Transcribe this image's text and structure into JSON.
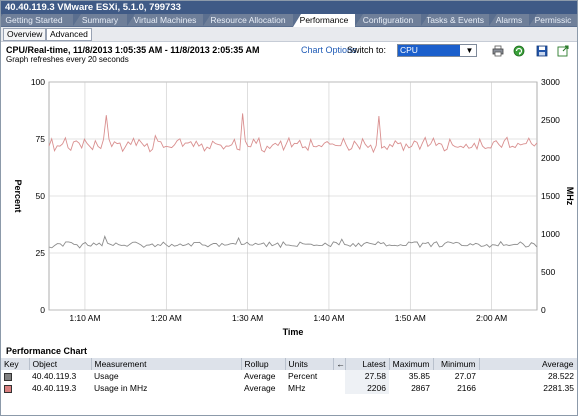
{
  "window": {
    "title": "40.40.119.3 VMware ESXi, 5.1.0, 799733"
  },
  "tabs": [
    {
      "label": "Getting Started"
    },
    {
      "label": "Summary"
    },
    {
      "label": "Virtual Machines"
    },
    {
      "label": "Resource Allocation"
    },
    {
      "label": "Performance"
    },
    {
      "label": "Configuration"
    },
    {
      "label": "Tasks & Events"
    },
    {
      "label": "Alarms"
    },
    {
      "label": "Permissic"
    }
  ],
  "subtabs": [
    {
      "label": "Overview"
    },
    {
      "label": "Advanced"
    }
  ],
  "chart_header": {
    "title": "CPU/Real-time, 11/8/2013 1:05:35 AM - 11/8/2013 2:05:35 AM",
    "chart_options_link": "Chart Options",
    "switch_label": "Switch to:",
    "switch_value": "CPU",
    "refresh_note": "Graph refreshes every 20 seconds"
  },
  "toolbar_icons": [
    {
      "name": "print-icon"
    },
    {
      "name": "refresh-icon"
    },
    {
      "name": "save-icon"
    },
    {
      "name": "popout-icon"
    }
  ],
  "colors": {
    "usage": "#d98f8f",
    "usage_mhz": "#8c8c8c",
    "swatch_usage": "#808080",
    "swatch_mhz": "#d98080",
    "grid": "#c8c8c8"
  },
  "chart_data": {
    "type": "line",
    "xlabel": "Time",
    "ylabel": "Percent",
    "y2label": "MHz",
    "ylim": [
      0,
      100
    ],
    "y2lim": [
      0,
      3000
    ],
    "yticks": [
      "0",
      "25",
      "50",
      "75",
      "100"
    ],
    "y2ticks": [
      "0",
      "500",
      "1000",
      "1500",
      "2000",
      "2500",
      "3000"
    ],
    "x_range_minutes": [
      65.58,
      125.58
    ],
    "xticks": [
      {
        "label": "1:10 AM",
        "minute": 70
      },
      {
        "label": "1:20 AM",
        "minute": 80
      },
      {
        "label": "1:30 AM",
        "minute": 90
      },
      {
        "label": "1:40 AM",
        "minute": 100
      },
      {
        "label": "1:50 AM",
        "minute": 110
      },
      {
        "label": "2:00 AM",
        "minute": 120
      }
    ],
    "grid": true,
    "series": [
      {
        "name": "Usage in MHz",
        "axis": "right",
        "values": [
          2156,
          2252,
          2095,
          2160,
          2156,
          2187,
          2266,
          2134,
          2101,
          2210,
          2225,
          2197,
          2131,
          2248,
          2190,
          2150,
          2111,
          2228,
          2151,
          2125,
          2245,
          2563,
          2246,
          2150,
          2213,
          2190,
          2198,
          2088,
          2146,
          2212,
          2178,
          2259,
          2165,
          2242,
          2197,
          2154,
          2188,
          2083,
          2116,
          2294,
          2218,
          2213,
          2139,
          2154,
          2146,
          2137,
          2171,
          2228,
          2252,
          2153,
          2196,
          2197,
          2215,
          2151,
          2221,
          2156,
          2184,
          2094,
          2144,
          2122,
          2221,
          2191,
          2179,
          2169,
          2118,
          2158,
          2155,
          2174,
          2245,
          2117,
          2105,
          2587,
          2224,
          2151,
          2148,
          2248,
          2194,
          2262,
          2103,
          2079,
          2155,
          2125,
          2171,
          2193,
          2165,
          2222,
          2105,
          2182,
          2265,
          2146,
          2193,
          2190,
          2231,
          2136,
          2147,
          2103,
          2244,
          2151,
          2147,
          2166,
          2149,
          2196,
          2216,
          2183,
          2185,
          2167,
          2162,
          2162,
          2257,
          2170,
          2103,
          2123,
          2221,
          2175,
          2118,
          2252,
          2182,
          2138,
          2170,
          2078,
          2164,
          2551,
          2131,
          2151,
          2112,
          2179,
          2150,
          2226,
          2188,
          2200,
          2100,
          2184,
          2134,
          2153,
          2224,
          2206,
          2116,
          2200,
          2270,
          2152,
          2185,
          2261,
          2164,
          2194,
          2181,
          2095,
          2114,
          2248,
          2172,
          2149,
          2141,
          2155,
          2135,
          2180,
          2129,
          2140,
          2194,
          2119,
          2249,
          2156,
          2125,
          2136,
          2131,
          2209,
          2228,
          2179,
          2141,
          2228,
          2272,
          2139,
          2154,
          2138,
          2193,
          2172,
          2185,
          2190,
          2261,
          2188,
          2158,
          2200
        ]
      },
      {
        "name": "Usage",
        "axis": "left",
        "values": [
          27.65,
          27.26,
          28.27,
          29.12,
          29.03,
          27.99,
          29.86,
          29.87,
          29.61,
          28.78,
          28.65,
          27.22,
          28.9,
          29.59,
          28.27,
          28.01,
          29.39,
          28.52,
          29.34,
          28.17,
          32.28,
          29.26,
          28.81,
          28.31,
          29.45,
          28.64,
          28.32,
          28.4,
          27.95,
          28.81,
          29.7,
          29.79,
          29.19,
          28.49,
          27.52,
          28.43,
          28.51,
          28.97,
          27.76,
          28.73,
          28.31,
          29.72,
          28.65,
          27.72,
          28.82,
          28.02,
          28.28,
          29.0,
          28.26,
          28.49,
          29.12,
          28.01,
          29.58,
          29.57,
          29.69,
          28.53,
          28.43,
          27.7,
          28.6,
          29.17,
          29.22,
          27.83,
          29.15,
          28.43,
          28.58,
          29.05,
          29.2,
          28.88,
          31.6,
          28.71,
          28.88,
          29.7,
          28.58,
          28.44,
          29.26,
          28.76,
          28.98,
          29.44,
          27.79,
          29.75,
          28.19,
          28.74,
          29.39,
          27.48,
          29.86,
          28.49,
          28.46,
          28.19,
          28.11,
          27.88,
          29.79,
          29.06,
          28.86,
          28.9,
          28.88,
          28.28,
          28.46,
          28.26,
          28.33,
          29.33,
          28.46,
          27.86,
          29.88,
          29.57,
          28.6,
          31.05,
          28.72,
          28.51,
          27.94,
          29.18,
          27.88,
          29.28,
          27.93,
          29.17,
          29.64,
          29.24,
          28.98,
          28.7,
          29.95,
          29.14,
          29.52,
          28.09,
          28.51,
          28.26,
          28.37,
          28.1,
          28.65,
          28.26,
          28.25,
          29.83,
          29.49,
          29.85,
          29.83,
          27.57,
          29.36,
          29.2,
          29.64,
          27.82,
          29.38,
          29.93,
          27.69,
          27.92,
          29.3,
          29.9,
          29.66,
          29.23,
          29.71,
          29.37,
          28.35,
          28.18,
          28.19,
          29.07,
          28.52,
          29.2,
          28.9,
          27.88,
          28.06,
          28.72,
          27.53,
          28.66,
          28.53,
          28.11,
          29.96,
          28.35,
          28.66,
          28.27,
          28.56,
          28.8,
          28.75,
          29.85,
          28.94,
          27.65,
          27.9,
          29.5,
          28.98,
          27.58
        ]
      }
    ]
  },
  "performance_chart": {
    "title": "Performance Chart",
    "columns": [
      "Key",
      "Object",
      "Measurement",
      "Rollup",
      "Units",
      "←",
      "Latest",
      "Maximum",
      "Minimum",
      "Average"
    ],
    "rows": [
      {
        "object": "40.40.119.3",
        "measurement": "Usage",
        "rollup": "Average",
        "units": "Percent",
        "latest": "27.58",
        "maximum": "35.85",
        "minimum": "27.07",
        "average": "28.522"
      },
      {
        "object": "40.40.119.3",
        "measurement": "Usage in MHz",
        "rollup": "Average",
        "units": "MHz",
        "latest": "2206",
        "maximum": "2867",
        "minimum": "2166",
        "average": "2281.35"
      }
    ]
  }
}
